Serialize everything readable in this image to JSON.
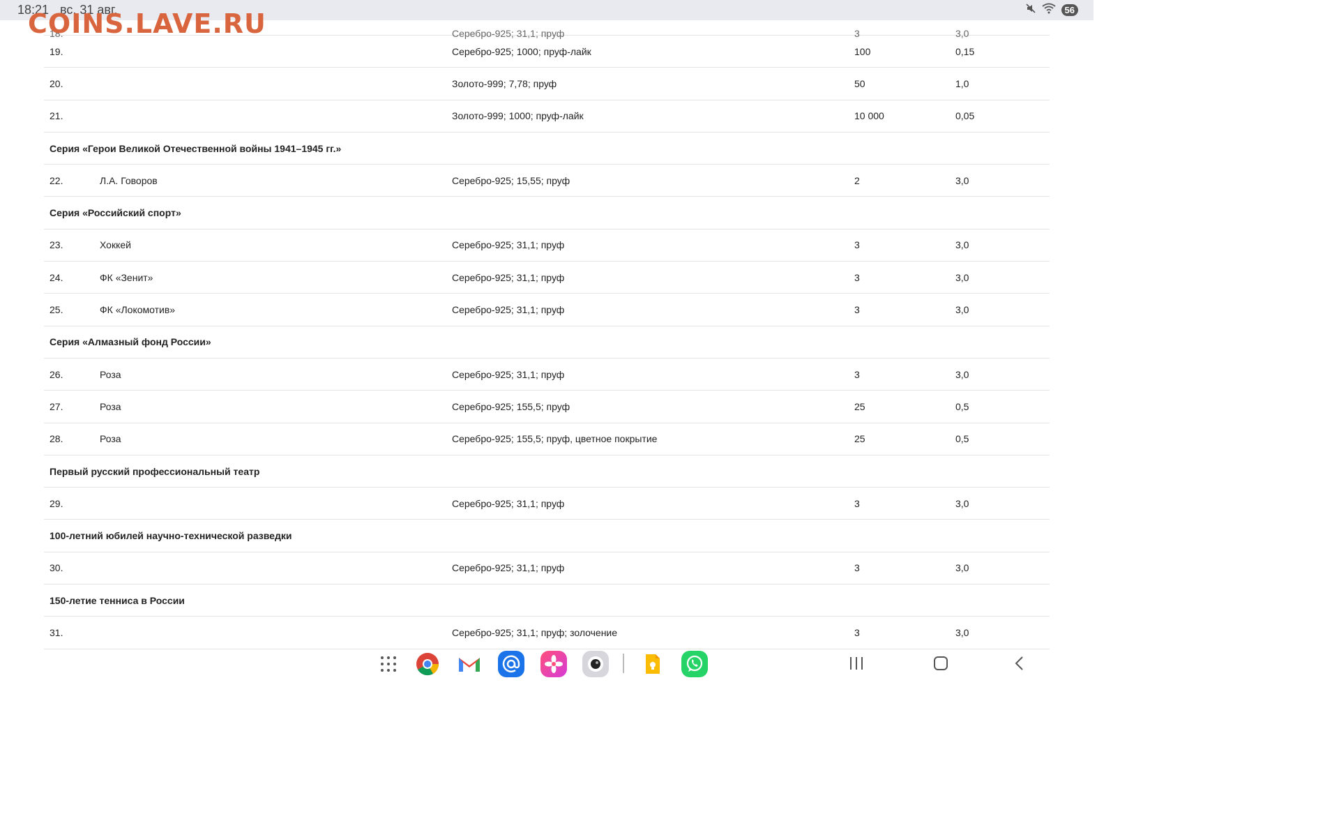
{
  "status": {
    "time": "18:21",
    "date": "вс, 31 авг.",
    "battery": "56"
  },
  "watermark": "COINS.LAVE.RU",
  "partial_row": {
    "num": "18.",
    "spec": "Серебро-925; 31,1; пруф",
    "qty": "3",
    "val": "3,0"
  },
  "rows": [
    {
      "type": "item",
      "num": "19.",
      "name": "",
      "spec": "Серебро-925; 1000; пруф-лайк",
      "qty": "100",
      "val": "0,15"
    },
    {
      "type": "item",
      "num": "20.",
      "name": "",
      "spec": "Золото-999; 7,78; пруф",
      "qty": "50",
      "val": "1,0"
    },
    {
      "type": "item",
      "num": "21.",
      "name": "",
      "spec": "Золото-999; 1000; пруф-лайк",
      "qty": "10 000",
      "val": "0,05"
    },
    {
      "type": "series",
      "title": "Серия «Герои Великой Отечественной войны 1941–1945 гг.»"
    },
    {
      "type": "item",
      "num": "22.",
      "name": "Л.А. Говоров",
      "spec": "Серебро-925; 15,55; пруф",
      "qty": "2",
      "val": "3,0"
    },
    {
      "type": "series",
      "title": "Серия «Российский спорт»"
    },
    {
      "type": "item",
      "num": "23.",
      "name": "Хоккей",
      "spec": "Серебро-925; 31,1; пруф",
      "qty": "3",
      "val": "3,0"
    },
    {
      "type": "item",
      "num": "24.",
      "name": "ФК «Зенит»",
      "spec": "Серебро-925; 31,1; пруф",
      "qty": "3",
      "val": "3,0"
    },
    {
      "type": "item",
      "num": "25.",
      "name": "ФК «Локомотив»",
      "spec": "Серебро-925; 31,1; пруф",
      "qty": "3",
      "val": "3,0"
    },
    {
      "type": "series",
      "title": "Серия «Алмазный фонд России»"
    },
    {
      "type": "item",
      "num": "26.",
      "name": "Роза",
      "spec": "Серебро-925; 31,1; пруф",
      "qty": "3",
      "val": "3,0"
    },
    {
      "type": "item",
      "num": "27.",
      "name": "Роза",
      "spec": "Серебро-925; 155,5; пруф",
      "qty": "25",
      "val": "0,5"
    },
    {
      "type": "item",
      "num": "28.",
      "name": "Роза",
      "spec": "Серебро-925; 155,5; пруф, цветное покрытие",
      "qty": "25",
      "val": "0,5"
    },
    {
      "type": "series",
      "title": "Первый русский профессиональный театр"
    },
    {
      "type": "item",
      "num": "29.",
      "name": "",
      "spec": "Серебро-925; 31,1; пруф",
      "qty": "3",
      "val": "3,0"
    },
    {
      "type": "series",
      "title": "100-летний юбилей научно-технической разведки"
    },
    {
      "type": "item",
      "num": "30.",
      "name": "",
      "spec": "Серебро-925; 31,1; пруф",
      "qty": "3",
      "val": "3,0"
    },
    {
      "type": "series",
      "title": "150-летие тенниса в России"
    },
    {
      "type": "item",
      "num": "31.",
      "name": "",
      "spec": "Серебро-925; 31,1; пруф; золочение",
      "qty": "3",
      "val": "3,0"
    }
  ],
  "dock": {
    "apps": [
      "apps-grid-icon",
      "chrome-icon",
      "gmail-icon",
      "mail-icon",
      "photos-icon",
      "camera-icon",
      "notes-icon",
      "whatsapp-icon"
    ],
    "nav": [
      "recents-icon",
      "home-icon",
      "back-icon"
    ]
  }
}
